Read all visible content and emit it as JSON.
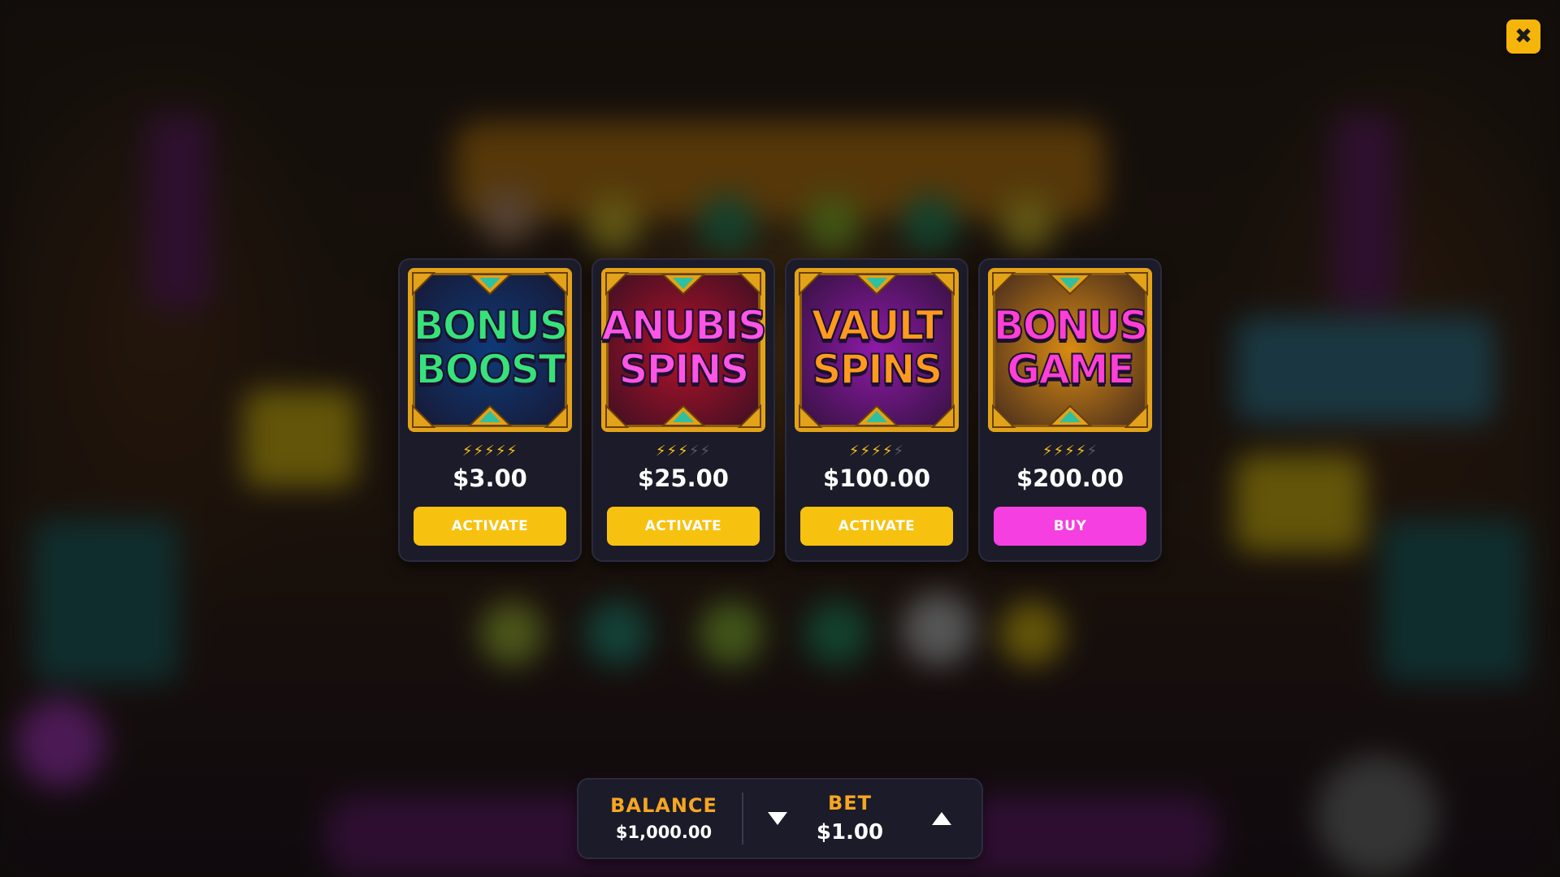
{
  "close_button": {
    "icon": "close-icon",
    "glyph": "✖",
    "color": "#f5b50a"
  },
  "offers": [
    {
      "title_line1": "BONUS",
      "title_line2": "BOOST",
      "title_color": "#37e27a",
      "art_bg": "#0e3a78",
      "rating": 5,
      "rating_max": 5,
      "price": "$3.00",
      "action_label": "ACTIVATE",
      "action_color": "#f7c10f"
    },
    {
      "title_line1": "ANUBIS",
      "title_line2": "SPINS",
      "title_color": "#ff55e6",
      "art_bg": "#b3122a",
      "rating": 3,
      "rating_max": 5,
      "price": "$25.00",
      "action_label": "ACTIVATE",
      "action_color": "#f7c10f"
    },
    {
      "title_line1": "VAULT",
      "title_line2": "SPINS",
      "title_color": "#ff9a1f",
      "art_bg": "#8e1aa8",
      "rating": 4,
      "rating_max": 5,
      "price": "$100.00",
      "action_label": "ACTIVATE",
      "action_color": "#f7c10f"
    },
    {
      "title_line1": "BONUS",
      "title_line2": "GAME",
      "title_color": "#ff3fd6",
      "art_bg": "#d98b12",
      "rating": 4,
      "rating_max": 5,
      "price": "$200.00",
      "action_label": "BUY",
      "action_color": "#f53fe0"
    }
  ],
  "bottom_bar": {
    "balance_label": "BALANCE",
    "balance_value": "$1,000.00",
    "bet_label": "BET",
    "bet_value": "$1.00",
    "decrease_icon": "triangle-down-icon",
    "increase_icon": "triangle-up-icon"
  }
}
